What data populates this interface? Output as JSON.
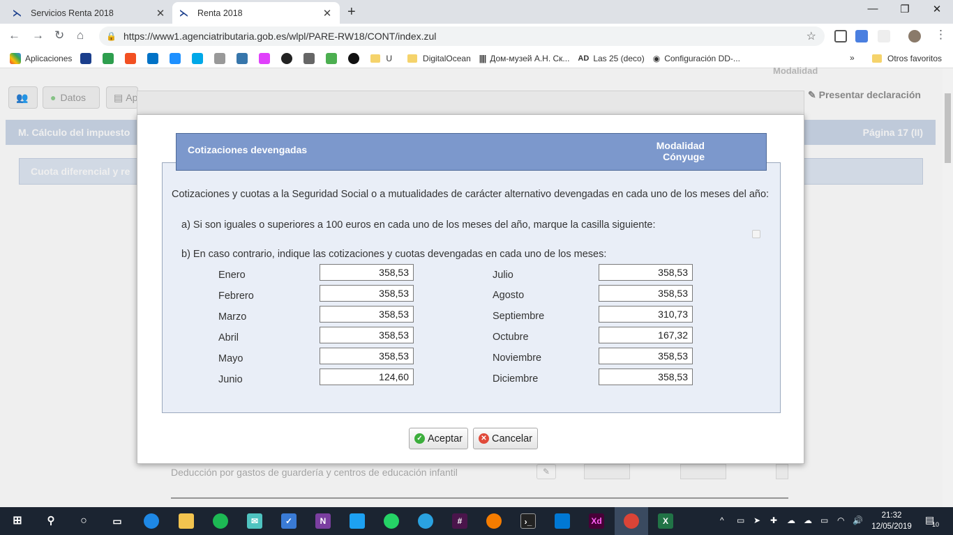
{
  "browser": {
    "tabs": [
      {
        "title": "Servicios Renta 2018",
        "active": false
      },
      {
        "title": "Renta 2018",
        "active": true
      }
    ],
    "url": "https://www1.agenciatributaria.gob.es/wlpl/PARE-RW18/CONT/index.zul",
    "bookmarks": [
      {
        "label": "Aplicaciones",
        "icon": "apps-grid-icon"
      },
      {
        "label": "U",
        "icon": "folder-icon"
      },
      {
        "label": "DigitalOcean",
        "icon": "folder-icon"
      },
      {
        "label": "Дом-музей А.Н. Ск...",
        "icon": "barcode-icon"
      },
      {
        "label": "Las 25 (deco)",
        "icon": "ad-logo-icon"
      },
      {
        "label": "Configuración DD-...",
        "icon": "globe-icon"
      }
    ],
    "more_bookmarks": "»",
    "other_favorites": "Otros favoritos"
  },
  "page": {
    "modalidad_top": "Modalidad",
    "datos_button": "Datos",
    "ap_button": "Ap",
    "present_button": "Presentar declaración",
    "section_title": "M.  Cálculo del impuesto",
    "page_label": "Página 17 (II)",
    "subsection": "Cuota diferencial y re",
    "background_row": "Deducción por gastos de guardería y centros de educación infantil"
  },
  "modal": {
    "title": "Cotizaciones devengadas",
    "modalidad_line1": "Modalidad",
    "modalidad_line2": "Cónyuge",
    "intro": "Cotizaciones y cuotas a la Seguridad Social o a mutualidades de carácter alternativo devengadas en cada uno de los meses del año:",
    "option_a": "a) Si son iguales o superiores a 100 euros en cada uno de los meses del año, marque la casilla siguiente:",
    "option_a_checked": false,
    "option_b": "b) En caso contrario, indique las cotizaciones y cuotas devengadas en cada uno de los meses:",
    "months_left": [
      {
        "label": "Enero",
        "value": "358,53"
      },
      {
        "label": "Febrero",
        "value": "358,53"
      },
      {
        "label": "Marzo",
        "value": "358,53"
      },
      {
        "label": "Abril",
        "value": "358,53"
      },
      {
        "label": "Mayo",
        "value": "358,53"
      },
      {
        "label": "Junio",
        "value": "124,60"
      }
    ],
    "months_right": [
      {
        "label": "Julio",
        "value": "358,53"
      },
      {
        "label": "Agosto",
        "value": "358,53"
      },
      {
        "label": "Septiembre",
        "value": "310,73"
      },
      {
        "label": "Octubre",
        "value": "167,32"
      },
      {
        "label": "Noviembre",
        "value": "358,53"
      },
      {
        "label": "Diciembre",
        "value": "358,53"
      }
    ],
    "accept_label": "Aceptar",
    "cancel_label": "Cancelar"
  },
  "taskbar": {
    "time": "21:32",
    "date": "12/05/2019",
    "notifications": "10"
  },
  "colors": {
    "modal_header": "#7c98cc",
    "modal_body": "#e9eef7",
    "taskbar": "#1b2431"
  }
}
